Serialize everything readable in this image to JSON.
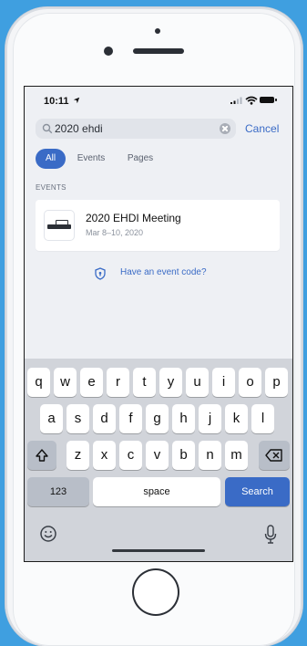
{
  "status": {
    "time": "10:11"
  },
  "search": {
    "value": "2020 ehdi",
    "cancel_label": "Cancel"
  },
  "tabs": [
    {
      "label": "All",
      "active": true
    },
    {
      "label": "Events",
      "active": false
    },
    {
      "label": "Pages",
      "active": false
    }
  ],
  "results": {
    "section_header": "EVENTS",
    "items": [
      {
        "title": "2020 EHDI Meeting",
        "date": "Mar 8–10, 2020"
      }
    ]
  },
  "event_code_link": "Have an event code?",
  "keyboard": {
    "row1": [
      "q",
      "w",
      "e",
      "r",
      "t",
      "y",
      "u",
      "i",
      "o",
      "p"
    ],
    "row2": [
      "a",
      "s",
      "d",
      "f",
      "g",
      "h",
      "j",
      "k",
      "l"
    ],
    "row3": [
      "z",
      "x",
      "c",
      "v",
      "b",
      "n",
      "m"
    ],
    "numbers_label": "123",
    "space_label": "space",
    "search_label": "Search"
  },
  "icons": {
    "location": "location-arrow-icon",
    "search": "magnifier-icon",
    "clear": "clear-circle-icon",
    "shield": "shield-icon",
    "shift": "shift-arrow-icon",
    "delete": "backspace-icon",
    "emoji": "emoji-face-icon",
    "microphone": "microphone-icon"
  },
  "colors": {
    "accent": "#3a6bc6",
    "background": "#3f9fe0",
    "screen_bg": "#eef0f4"
  }
}
